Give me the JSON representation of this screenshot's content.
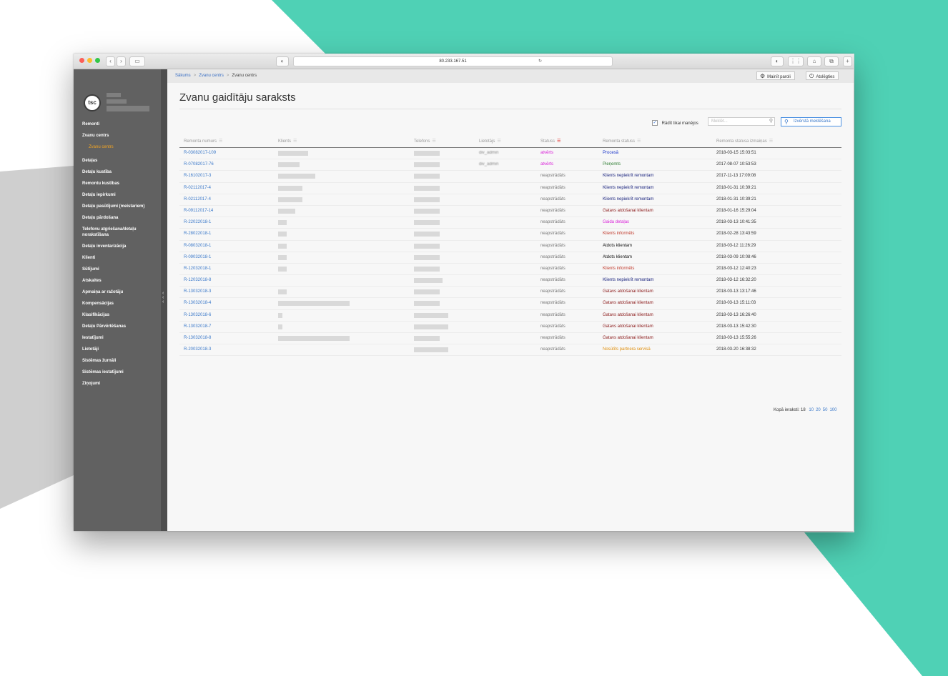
{
  "browser": {
    "url": "80.233.167.51"
  },
  "sidebar": {
    "logo_text": "tsc",
    "items": [
      {
        "label": "Remonti",
        "sub": false
      },
      {
        "label": "Zvanu centrs",
        "sub": false
      },
      {
        "label": "Zvanu centrs",
        "sub": true
      },
      {
        "label": "Detaļas",
        "sub": false
      },
      {
        "label": "Detaļu kustība",
        "sub": false
      },
      {
        "label": "Remontu kustības",
        "sub": false
      },
      {
        "label": "Detaļu iepirkumi",
        "sub": false
      },
      {
        "label": "Detaļu pasūtījumi (meistariem)",
        "sub": false
      },
      {
        "label": "Detaļu pārdošana",
        "sub": false
      },
      {
        "label": "Telefonu atgriešana/detaļu norakstīšana",
        "sub": false
      },
      {
        "label": "Detaļu inventarizācija",
        "sub": false
      },
      {
        "label": "Klienti",
        "sub": false
      },
      {
        "label": "Sūtījumi",
        "sub": false
      },
      {
        "label": "Atskaites",
        "sub": false
      },
      {
        "label": "Apmaiņa ar ražotāju",
        "sub": false
      },
      {
        "label": "Kompensācijas",
        "sub": false
      },
      {
        "label": "Klasifikācijas",
        "sub": false
      },
      {
        "label": "Detaļu Pārvērtēšanas",
        "sub": false
      },
      {
        "label": "Iestatījumi",
        "sub": false
      },
      {
        "label": "Lietotāji",
        "sub": false
      },
      {
        "label": "Sistēmas žurnāli",
        "sub": false
      },
      {
        "label": "Sistēmas iestatījumi",
        "sub": false
      },
      {
        "label": "Ziņojumi",
        "sub": false
      }
    ]
  },
  "breadcrumb": {
    "home": "Sākums",
    "parent": "Zvanu centrs",
    "current": "Zvanu centrs"
  },
  "topbar": {
    "change_password": "Mainīt paroli",
    "logout": "Atslēgties"
  },
  "page": {
    "title": "Zvanu gaidītāju saraksts",
    "only_mine_label": "Rādīt tikai manējos",
    "search_placeholder": "Meklēt...",
    "advanced_search": "Izvērstā meklēšana"
  },
  "table": {
    "columns": [
      "Remonta numurs",
      "Klients",
      "Telefons",
      "Lietotājs",
      "Statuss",
      "Remonta statuss",
      "Remonta statusa izmaiņas"
    ],
    "rows": [
      {
        "number": "R-03082017-109",
        "user": "div_admin",
        "status": "atvērts",
        "status_color": "#d81bd8",
        "repair_status": "Procesā",
        "repair_color": "#1a35c9",
        "date": "2018-03-15 15:03:51"
      },
      {
        "number": "R-07082017-76",
        "user": "div_admin",
        "status": "atvērts",
        "status_color": "#d81bd8",
        "repair_status": "Pieņemts",
        "repair_color": "#2e7d32",
        "date": "2017-08-07 10:53:53"
      },
      {
        "number": "R-16102017-3",
        "user": "",
        "status": "neapstrādāts",
        "status_color": "#777777",
        "repair_status": "Klients nepiekrīt remontam",
        "repair_color": "#1a237e",
        "date": "2017-11-13 17:09:08"
      },
      {
        "number": "R-02112017-4",
        "user": "",
        "status": "neapstrādāts",
        "status_color": "#777777",
        "repair_status": "Klients nepiekrīt remontam",
        "repair_color": "#1a237e",
        "date": "2018-01-31 10:39:21"
      },
      {
        "number": "R-02112017-4",
        "user": "",
        "status": "neapstrādāts",
        "status_color": "#777777",
        "repair_status": "Klients nepiekrīt remontam",
        "repair_color": "#1a237e",
        "date": "2018-01-31 10:39:21"
      },
      {
        "number": "R-09112017-14",
        "user": "",
        "status": "neapstrādāts",
        "status_color": "#777777",
        "repair_status": "Gatavs atdošanai klientam",
        "repair_color": "#8b1a1a",
        "date": "2018-01-16 15:29:04"
      },
      {
        "number": "R-22022018-1",
        "user": "",
        "status": "neapstrādāts",
        "status_color": "#777777",
        "repair_status": "Gaida detaļas",
        "repair_color": "#d81bd8",
        "date": "2018-03-13 10:41:35"
      },
      {
        "number": "R-28022018-1",
        "user": "",
        "status": "neapstrādāts",
        "status_color": "#777777",
        "repair_status": "Klients informēts",
        "repair_color": "#c0392b",
        "date": "2018-02-28 13:43:59"
      },
      {
        "number": "R-08032018-1",
        "user": "",
        "status": "neapstrādāts",
        "status_color": "#777777",
        "repair_status": "Atdots klientam",
        "repair_color": "#111111",
        "date": "2018-03-12 11:26:29"
      },
      {
        "number": "R-09032018-1",
        "user": "",
        "status": "neapstrādāts",
        "status_color": "#777777",
        "repair_status": "Atdots klientam",
        "repair_color": "#111111",
        "date": "2018-03-09 10:08:46"
      },
      {
        "number": "R-12032018-1",
        "user": "",
        "status": "neapstrādāts",
        "status_color": "#777777",
        "repair_status": "Klients informēts",
        "repair_color": "#c0392b",
        "date": "2018-03-12 12:40:23"
      },
      {
        "number": "R-12032018-8",
        "user": "",
        "status": "neapstrādāts",
        "status_color": "#777777",
        "repair_status": "Klients nepiekrīt remontam",
        "repair_color": "#1a237e",
        "date": "2018-03-12 16:32:20"
      },
      {
        "number": "R-13032018-3",
        "user": "",
        "status": "neapstrādāts",
        "status_color": "#777777",
        "repair_status": "Gatavs atdošanai klientam",
        "repair_color": "#8b1a1a",
        "date": "2018-03-13 13:17:46"
      },
      {
        "number": "R-13032018-4",
        "user": "",
        "status": "neapstrādāts",
        "status_color": "#777777",
        "repair_status": "Gatavs atdošanai klientam",
        "repair_color": "#8b1a1a",
        "date": "2018-03-13 15:11:03"
      },
      {
        "number": "R-13032018-6",
        "user": "",
        "status": "neapstrādāts",
        "status_color": "#777777",
        "repair_status": "Gatavs atdošanai klientam",
        "repair_color": "#8b1a1a",
        "date": "2018-03-13 16:26:40"
      },
      {
        "number": "R-13032018-7",
        "user": "",
        "status": "neapstrādāts",
        "status_color": "#777777",
        "repair_status": "Gatavs atdošanai klientam",
        "repair_color": "#8b1a1a",
        "date": "2018-03-13 15:42:30"
      },
      {
        "number": "R-13032018-8",
        "user": "",
        "status": "neapstrādāts",
        "status_color": "#777777",
        "repair_status": "Gatavs atdošanai klientam",
        "repair_color": "#8b1a1a",
        "date": "2018-03-13 15:55:26"
      },
      {
        "number": "R-20032018-3",
        "user": "",
        "status": "neapstrādāts",
        "status_color": "#777777",
        "repair_status": "Nosūtīts partnera servisā",
        "repair_color": "#e08e0b",
        "date": "2018-03-20 16:38:32"
      }
    ]
  },
  "footer": {
    "total_label": "Kopā ieraksti: 18",
    "page_sizes": [
      "10",
      "20",
      "50",
      "100"
    ]
  },
  "colors": {
    "accent_teal": "#4fd1b5",
    "sidebar": "#616161",
    "active_menu": "#f5a623",
    "link": "#3a78c9"
  }
}
